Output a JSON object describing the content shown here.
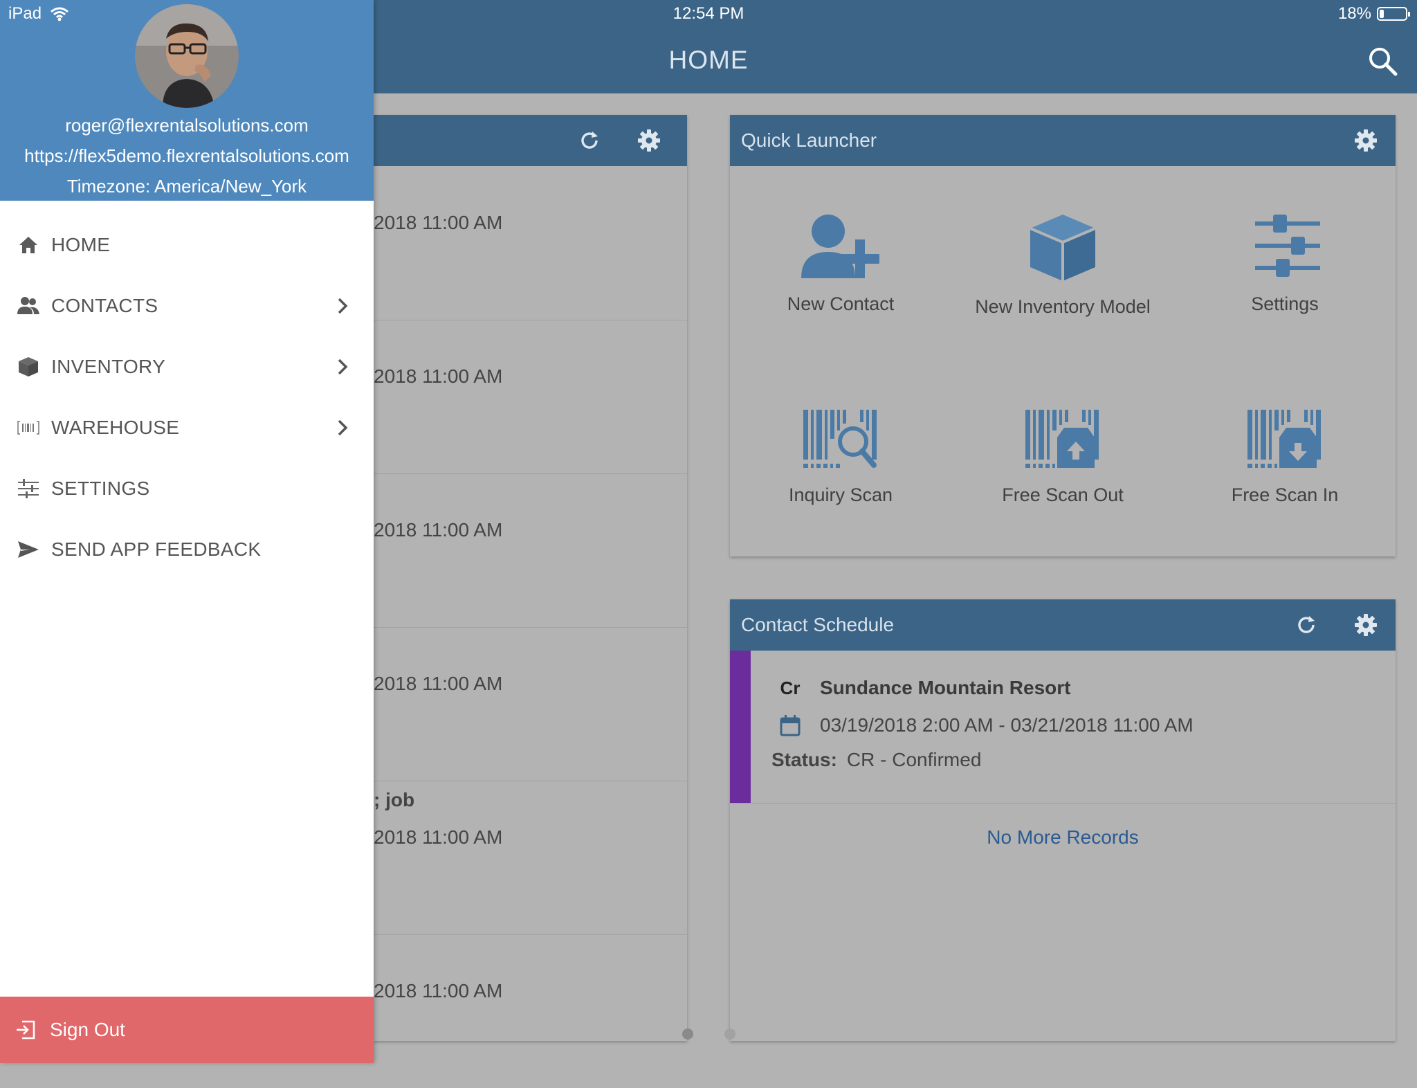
{
  "status_bar": {
    "device": "iPad",
    "time": "12:54 PM",
    "battery": "18%",
    "battery_level": 0.18
  },
  "appbar": {
    "title": "HOME"
  },
  "left_panel": {
    "rows": [
      {
        "datetime": "2018 11:00 AM"
      },
      {
        "datetime": "2018 11:00 AM"
      },
      {
        "datetime": "2018 11:00 AM"
      },
      {
        "datetime": "2018 11:00 AM"
      },
      {
        "title": "; job",
        "datetime": "2018 11:00 AM"
      },
      {
        "datetime": "2018 11:00 AM"
      }
    ]
  },
  "quick_launcher": {
    "title": "Quick Launcher",
    "items": [
      {
        "label": "New Contact",
        "icon": "user-plus-icon"
      },
      {
        "label": "New Inventory Model",
        "icon": "cube-icon"
      },
      {
        "label": "Settings",
        "icon": "sliders-icon"
      },
      {
        "label": "Inquiry Scan",
        "icon": "barcode-search-icon"
      },
      {
        "label": "Free Scan Out",
        "icon": "barcode-box-up-icon"
      },
      {
        "label": "Free Scan In",
        "icon": "barcode-box-down-icon"
      }
    ]
  },
  "contact_schedule": {
    "title": "Contact Schedule",
    "record": {
      "status_code": "Cr",
      "name": "Sundance Mountain Resort",
      "dates": "03/19/2018 2:00 AM - 03/21/2018 11:00 AM",
      "status_label": "Status:",
      "status_value": "CR - Confirmed",
      "accent_color": "#6a2d9b"
    },
    "no_more": "No More Records"
  },
  "drawer": {
    "email": "roger@flexrentalsolutions.com",
    "server": "https://flex5demo.flexrentalsolutions.com",
    "timezone": "Timezone: America/New_York",
    "menu": [
      {
        "label": "HOME",
        "icon": "home-icon",
        "has_submenu": false
      },
      {
        "label": "CONTACTS",
        "icon": "contacts-icon",
        "has_submenu": true
      },
      {
        "label": "INVENTORY",
        "icon": "cube-icon",
        "has_submenu": true
      },
      {
        "label": "WAREHOUSE",
        "icon": "barcode-icon",
        "has_submenu": true
      },
      {
        "label": "SETTINGS",
        "icon": "sliders-icon",
        "has_submenu": false
      },
      {
        "label": "SEND APP FEEDBACK",
        "icon": "paper-plane-icon",
        "has_submenu": false
      }
    ],
    "sign_out": "Sign Out"
  },
  "colors": {
    "appbar": "#3b6486",
    "drawer_header": "#4f88bc",
    "sign_out": "#e0676a",
    "icon_blue": "#4a7aa5",
    "link": "#2b5b91"
  }
}
